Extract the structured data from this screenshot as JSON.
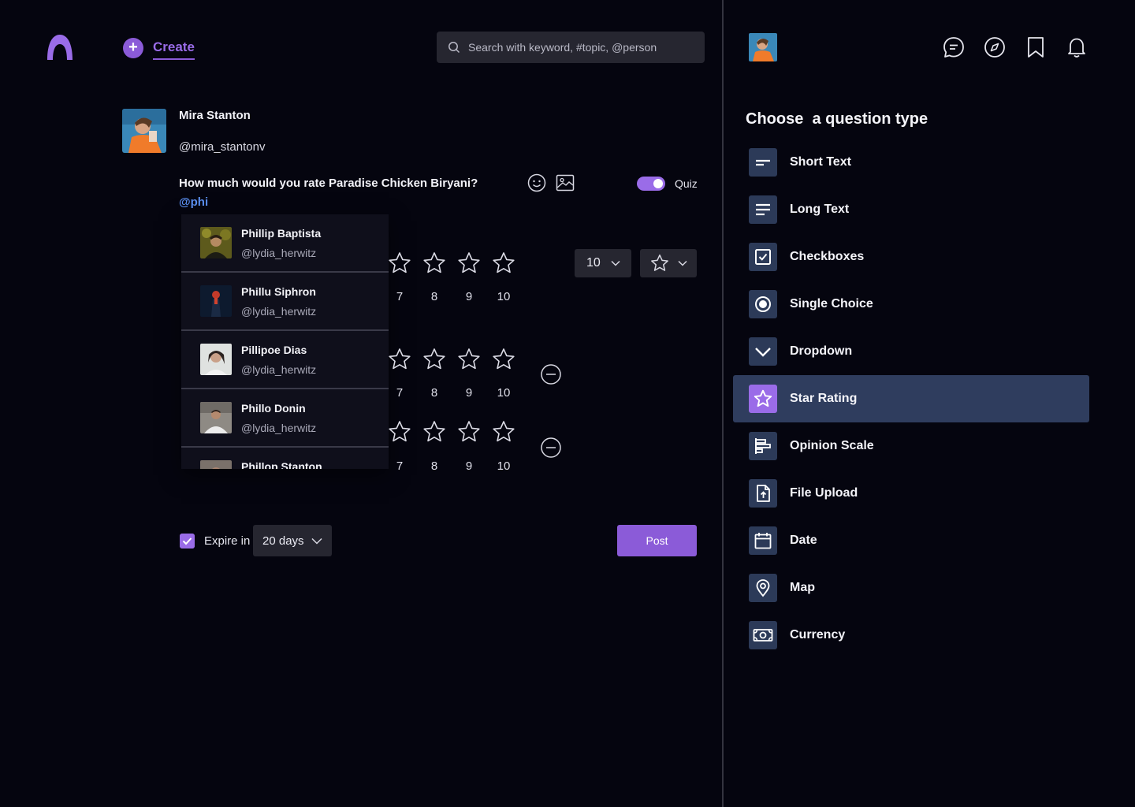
{
  "colors": {
    "accent": "#9a6ce8",
    "link": "#5b8ff0",
    "active_row": "#2f3d5e",
    "icon_bg": "#2c3a58",
    "background": "#05050f"
  },
  "header": {
    "create_label": "Create",
    "search_placeholder": "Search with keyword, #topic, @person"
  },
  "composer": {
    "user_name": "Mira Stanton",
    "user_handle": "@mira_stantonv",
    "question": "How much would you rate Paradise Chicken Biryani?",
    "mention_text": "@phi",
    "quiz_label": "Quiz",
    "quiz_enabled": true,
    "scale_count": "10",
    "rating_rows": [
      {
        "labels": [
          "7",
          "8",
          "9",
          "10"
        ]
      },
      {
        "labels": [
          "7",
          "8",
          "9",
          "10"
        ]
      },
      {
        "labels": [
          "7",
          "8",
          "9",
          "10"
        ]
      }
    ],
    "expire_checked": true,
    "expire_label": "Expire in",
    "expire_value": "20 days",
    "post_label": "Post"
  },
  "mention_suggestions": [
    {
      "name": "Phillip Baptista",
      "handle": "@lydia_herwitz"
    },
    {
      "name": "Phillu Siphron",
      "handle": "@lydia_herwitz"
    },
    {
      "name": "Pillipoe Dias",
      "handle": "@lydia_herwitz"
    },
    {
      "name": "Phillo Donin",
      "handle": "@lydia_herwitz"
    },
    {
      "name": "Phillop Stanton",
      "handle": ""
    }
  ],
  "panel": {
    "title": "Choose  a question type",
    "question_types": [
      {
        "label": "Short Text",
        "icon": "short-text-icon"
      },
      {
        "label": "Long Text",
        "icon": "long-text-icon"
      },
      {
        "label": "Checkboxes",
        "icon": "checkbox-icon"
      },
      {
        "label": "Single Choice",
        "icon": "radio-icon"
      },
      {
        "label": "Dropdown",
        "icon": "chevron-down-icon"
      },
      {
        "label": "Star Rating",
        "icon": "star-icon",
        "active": true
      },
      {
        "label": "Opinion Scale",
        "icon": "bar-chart-icon"
      },
      {
        "label": "File Upload",
        "icon": "file-upload-icon"
      },
      {
        "label": "Date",
        "icon": "calendar-icon"
      },
      {
        "label": "Map",
        "icon": "map-pin-icon"
      },
      {
        "label": "Currency",
        "icon": "currency-icon"
      }
    ]
  }
}
